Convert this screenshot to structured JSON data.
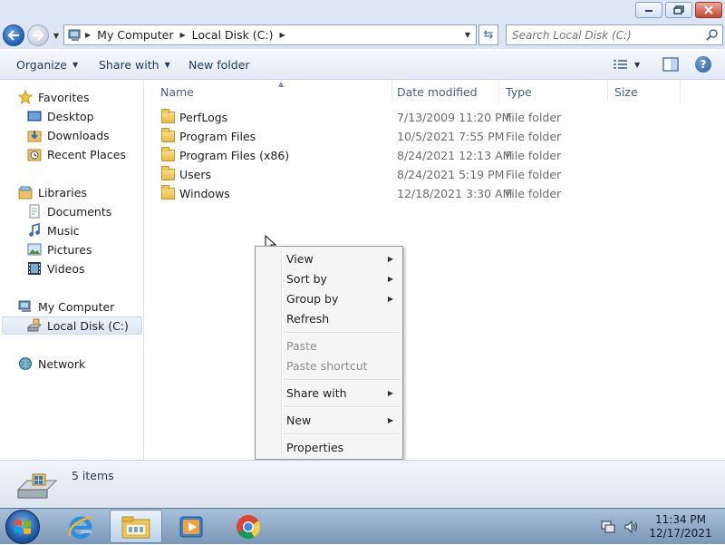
{
  "window": {
    "minimize_icon": "minimize-icon",
    "maximize_icon": "restore-icon",
    "close_icon": "close-icon",
    "close_color": "#c8452e"
  },
  "address": {
    "segments": [
      "My Computer",
      "Local Disk (C:)"
    ],
    "search_placeholder": "Search Local Disk (C:)"
  },
  "toolbar": {
    "organize": "Organize",
    "share_with": "Share with",
    "new_folder": "New folder"
  },
  "nav": {
    "favorites": "Favorites",
    "desktop": "Desktop",
    "downloads": "Downloads",
    "recent_places": "Recent Places",
    "libraries": "Libraries",
    "documents": "Documents",
    "music": "Music",
    "pictures": "Pictures",
    "videos": "Videos",
    "my_computer": "My Computer",
    "local_disk": "Local Disk (C:)",
    "network": "Network"
  },
  "columns": {
    "name": "Name",
    "date_modified": "Date modified",
    "type": "Type",
    "size": "Size"
  },
  "files": [
    {
      "name": "PerfLogs",
      "date": "7/13/2009 11:20 PM",
      "type": "File folder"
    },
    {
      "name": "Program Files",
      "date": "10/5/2021 7:55 PM",
      "type": "File folder"
    },
    {
      "name": "Program Files (x86)",
      "date": "8/24/2021 12:13 AM",
      "type": "File folder"
    },
    {
      "name": "Users",
      "date": "8/24/2021 5:19 PM",
      "type": "File folder"
    },
    {
      "name": "Windows",
      "date": "12/18/2021 3:30 AM",
      "type": "File folder"
    }
  ],
  "context_menu": {
    "view": "View",
    "sort_by": "Sort by",
    "group_by": "Group by",
    "refresh": "Refresh",
    "paste": "Paste",
    "paste_shortcut": "Paste shortcut",
    "share_with": "Share with",
    "new": "New",
    "properties": "Properties"
  },
  "status": {
    "item_count": "5 items"
  },
  "taskbar": {
    "time": "11:34 PM",
    "date": "12/17/2021",
    "apps": [
      "internet-explorer-icon",
      "file-explorer-icon",
      "media-player-icon",
      "chrome-icon"
    ]
  },
  "colors": {
    "accent": "#1e395b",
    "selection": "#dce7f5",
    "titlebar": "#dce6f4"
  }
}
